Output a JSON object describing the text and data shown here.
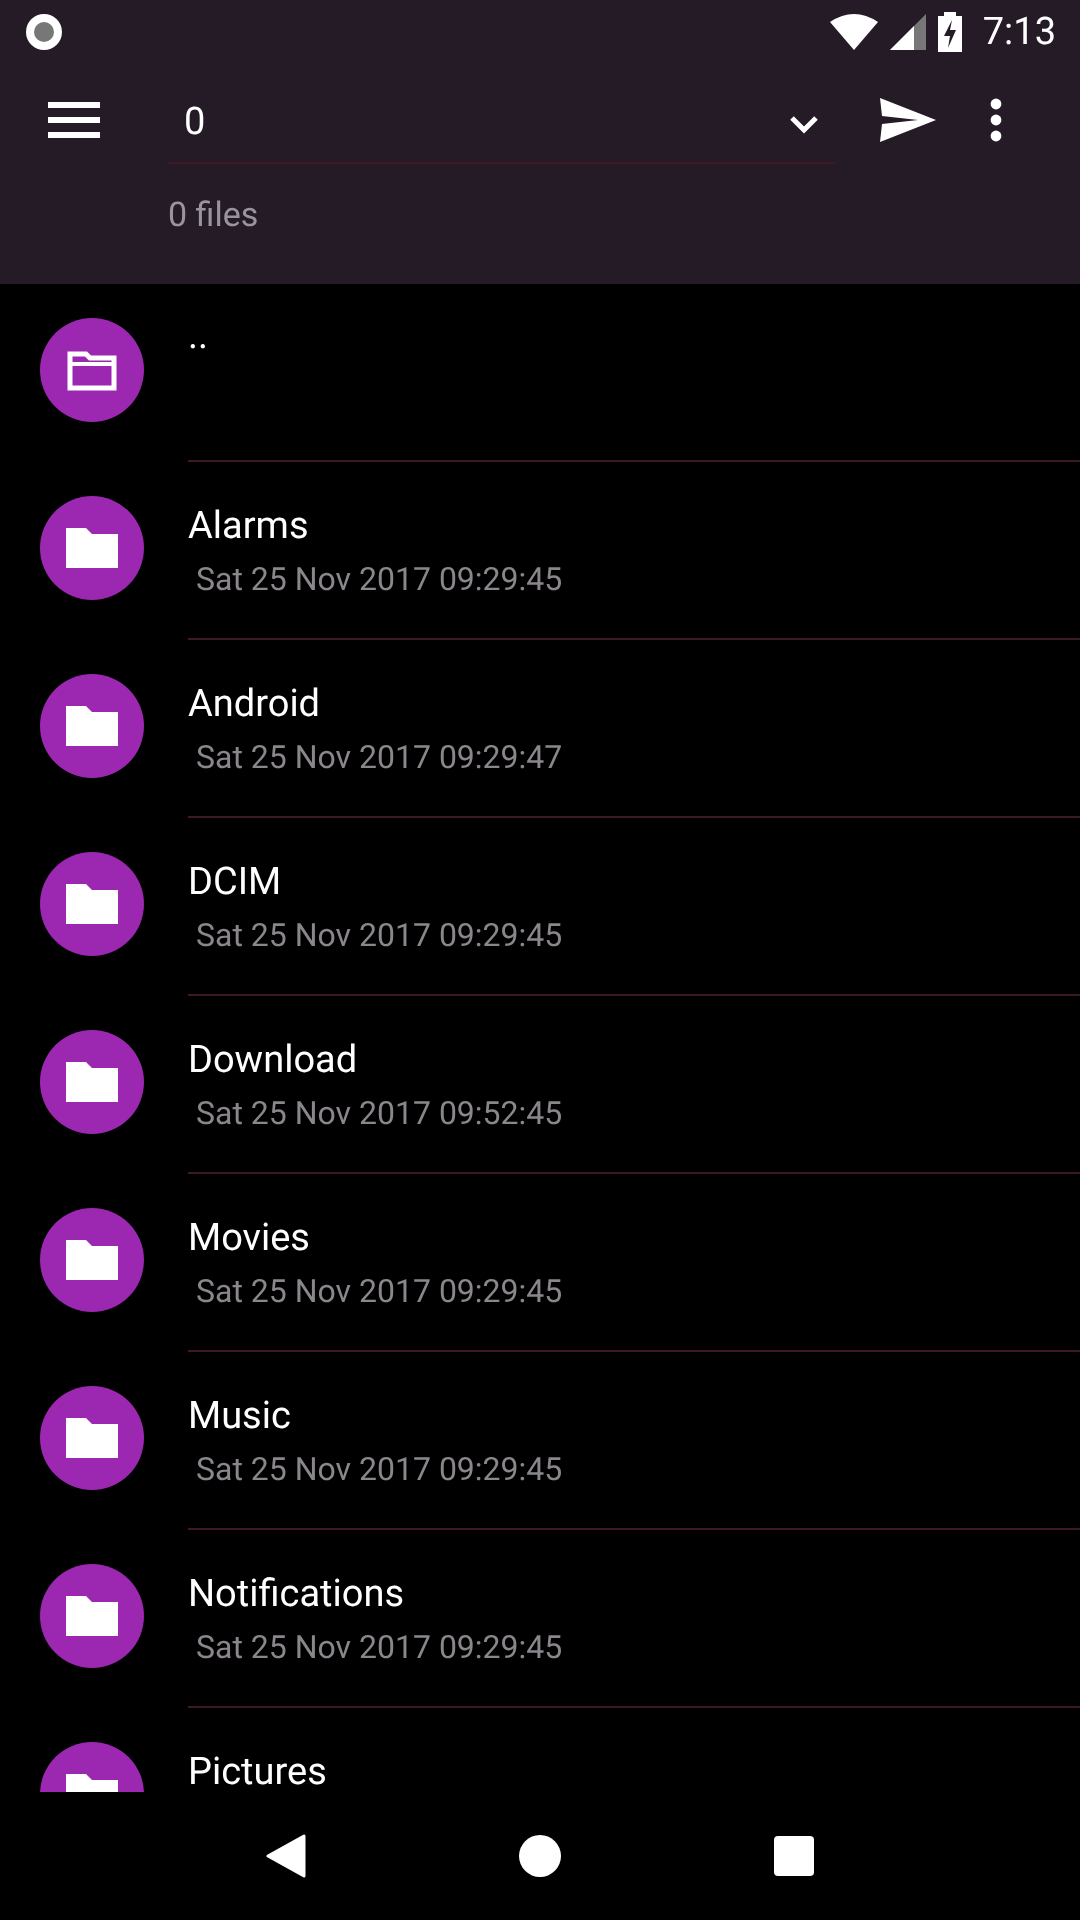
{
  "status_bar": {
    "time": "7:13"
  },
  "toolbar": {
    "path_field": {
      "value": "0"
    },
    "subtitle": "0 files"
  },
  "files": [
    {
      "kind": "parent",
      "name": ".."
    },
    {
      "kind": "folder",
      "name": "Alarms",
      "date": "Sat 25 Nov 2017 09:29:45"
    },
    {
      "kind": "folder",
      "name": "Android",
      "date": "Sat 25 Nov 2017 09:29:47"
    },
    {
      "kind": "folder",
      "name": "DCIM",
      "date": "Sat 25 Nov 2017 09:29:45"
    },
    {
      "kind": "folder",
      "name": "Download",
      "date": "Sat 25 Nov 2017 09:52:45"
    },
    {
      "kind": "folder",
      "name": "Movies",
      "date": "Sat 25 Nov 2017 09:29:45"
    },
    {
      "kind": "folder",
      "name": "Music",
      "date": "Sat 25 Nov 2017 09:29:45"
    },
    {
      "kind": "folder",
      "name": "Notifications",
      "date": "Sat 25 Nov 2017 09:29:45"
    },
    {
      "kind": "folder",
      "name": "Pictures"
    }
  ]
}
